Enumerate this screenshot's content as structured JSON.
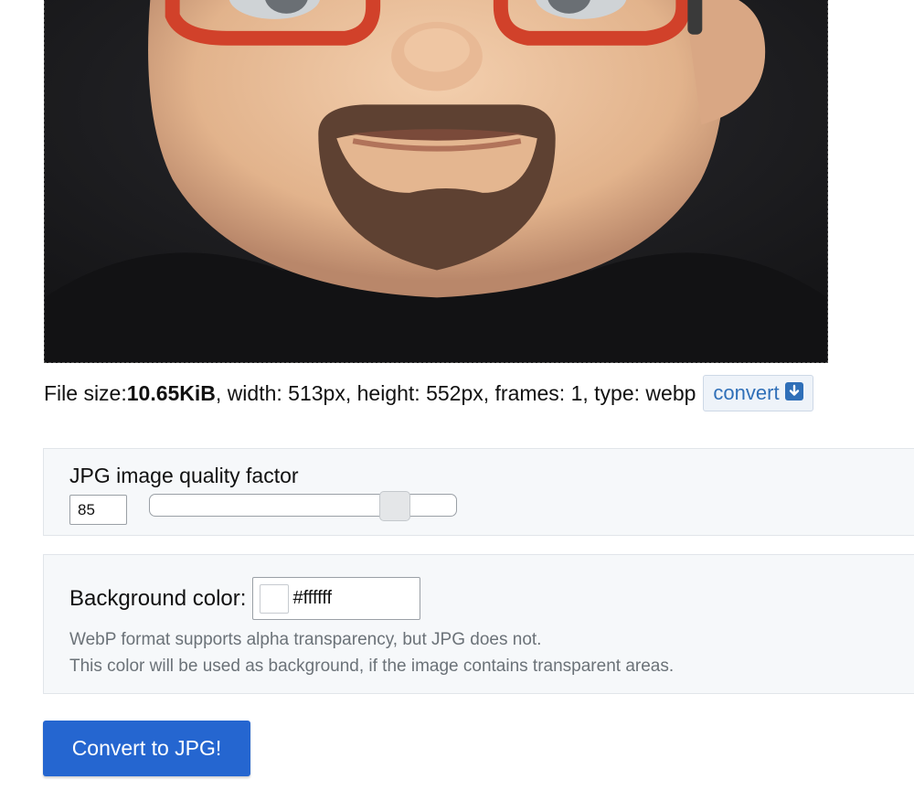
{
  "preview": {
    "alt": "memoji avatar with red glasses and goatee"
  },
  "file_info": {
    "size_label": "File size: ",
    "size_value": "10.65KiB",
    "details": ", width: 513px, height: 552px, frames: 1, type: webp",
    "convert_link": "convert",
    "convert_icon": "download-arrow-icon"
  },
  "quality": {
    "label": "JPG image quality factor",
    "value": "85",
    "slider_percent": 80
  },
  "background": {
    "label": "Background color:",
    "value": "#ffffff",
    "swatch_color": "#ffffff",
    "help_line1": "WebP format supports alpha transparency, but JPG does not.",
    "help_line2": "This color will be used as background, if the image contains transparent areas."
  },
  "submit": {
    "label": "Convert to JPG!"
  },
  "colors": {
    "accent": "#2566d0",
    "link": "#2f6fb8"
  }
}
